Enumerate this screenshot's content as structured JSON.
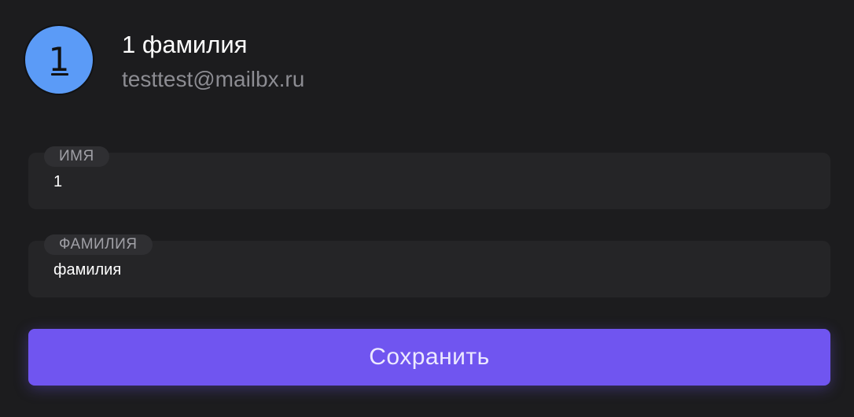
{
  "profile": {
    "avatar_letter": "1",
    "avatar_color": "#5b9bf7",
    "display_name": "1 фамилия",
    "email": "testtest@mailbx.ru"
  },
  "form": {
    "first_name": {
      "label": "ИМЯ",
      "value": "1"
    },
    "last_name": {
      "label": "ФАМИЛИЯ",
      "value": "фамилия"
    }
  },
  "actions": {
    "save_label": "Сохранить",
    "save_color": "#7055f0"
  }
}
